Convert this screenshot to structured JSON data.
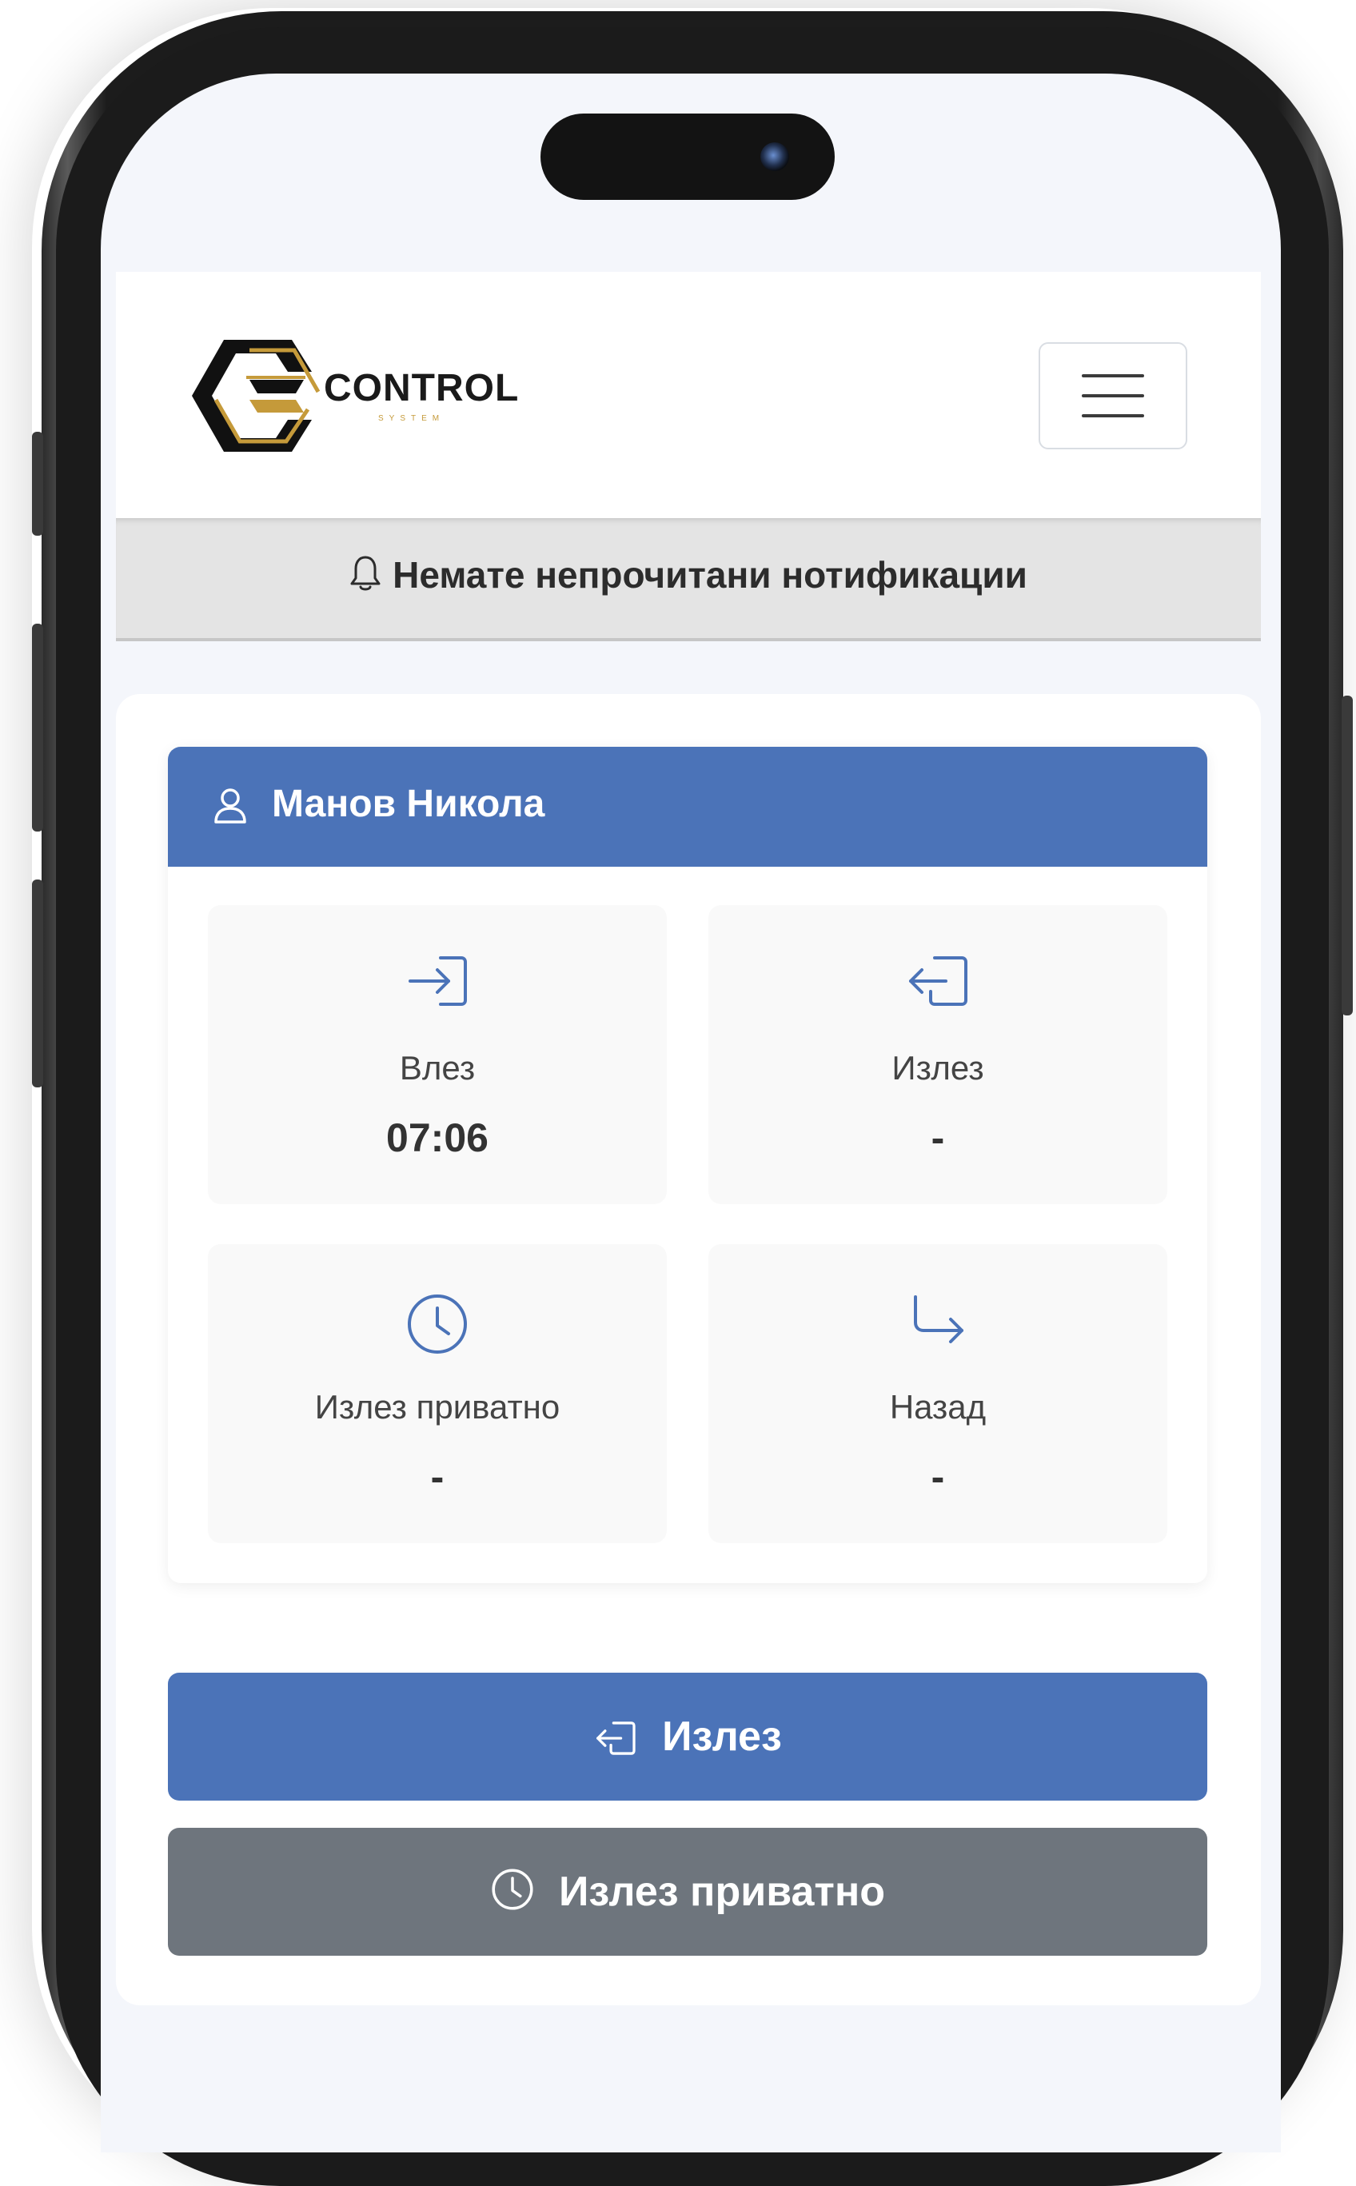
{
  "header": {
    "logo_title": "CONTROL",
    "logo_subtitle": "SYSTEM",
    "menu_icon": "hamburger-menu-icon"
  },
  "notification": {
    "icon": "bell-icon",
    "text": "Немате непрочитани нотификации"
  },
  "employee": {
    "icon": "user-icon",
    "name": "Манов Никола"
  },
  "tiles": [
    {
      "icon": "login-icon",
      "label": "Влез",
      "value": "07:06"
    },
    {
      "icon": "logout-icon",
      "label": "Излез",
      "value": "-"
    },
    {
      "icon": "clock-icon",
      "label": "Излез приватно",
      "value": "-"
    },
    {
      "icon": "return-arrow-icon",
      "label": "Назад",
      "value": "-"
    }
  ],
  "actions": {
    "exit_label": "Излез",
    "exit_icon": "logout-icon",
    "private_exit_label": "Излез приватно",
    "private_exit_icon": "clock-icon"
  },
  "colors": {
    "primary": "#4b73b8",
    "secondary": "#6e757d",
    "logo_gold": "#c59a3a",
    "notification_bg": "#e4e4e4"
  }
}
